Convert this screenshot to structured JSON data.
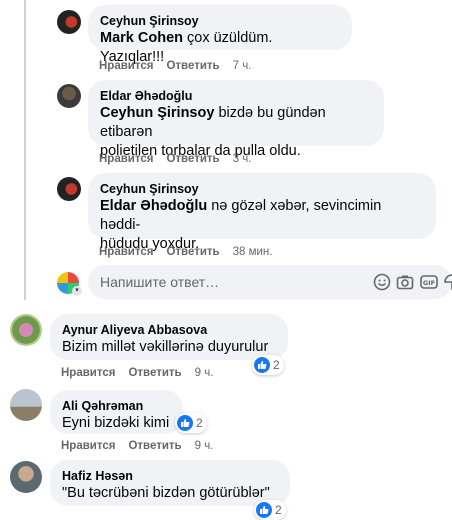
{
  "colors": {
    "bubble": "#f0f2f5",
    "secondary": "#65676b",
    "like": "#1877f2"
  },
  "comments": [
    {
      "author": "Ceyhun Şirinsoy",
      "mention": "Mark Cohen",
      "text": " çox üzüldüm. Yazıqlar!!!",
      "like": "Нравится",
      "reply": "Ответить",
      "time": "7 ч."
    },
    {
      "author": "Eldar Əhədoğlu",
      "mention": "Ceyhun Şirinsoy",
      "text_line1": " bizdə bu gündən etibarən",
      "text_line2": "polietilen torbalar da pulla oldu.",
      "like": "Нравится",
      "reply": "Ответить",
      "time": "3 ч."
    },
    {
      "author": "Ceyhun Şirinsoy",
      "mention": "Eldar Əhədoğlu",
      "text_line1": " nə gözəl xəbər, sevincimin həddi-",
      "text_line2": "hüdudu yoxdur.",
      "like": "Нравится",
      "reply": "Ответить",
      "time": "38 мин."
    },
    {
      "author": "Aynur Aliyeva Abbasova",
      "text": "Bizim millət vəkillərinə duyurulur",
      "like": "Нравится",
      "reply": "Ответить",
      "time": "9 ч.",
      "reactions": "2"
    },
    {
      "author": "Ali Qəhrəman",
      "text": "Eyni bizdəki kimi",
      "like": "Нравится",
      "reply": "Ответить",
      "time": "9 ч.",
      "reactions": "2"
    },
    {
      "author": "Hafiz Həsən",
      "text": "\"Bu təcrübəni bizdən götürüblər\"",
      "reactions": "2"
    }
  ],
  "reply_box": {
    "placeholder": "Напишите ответ…",
    "icons": [
      "emoji-icon",
      "camera-icon",
      "gif-icon",
      "sticker-icon"
    ]
  }
}
